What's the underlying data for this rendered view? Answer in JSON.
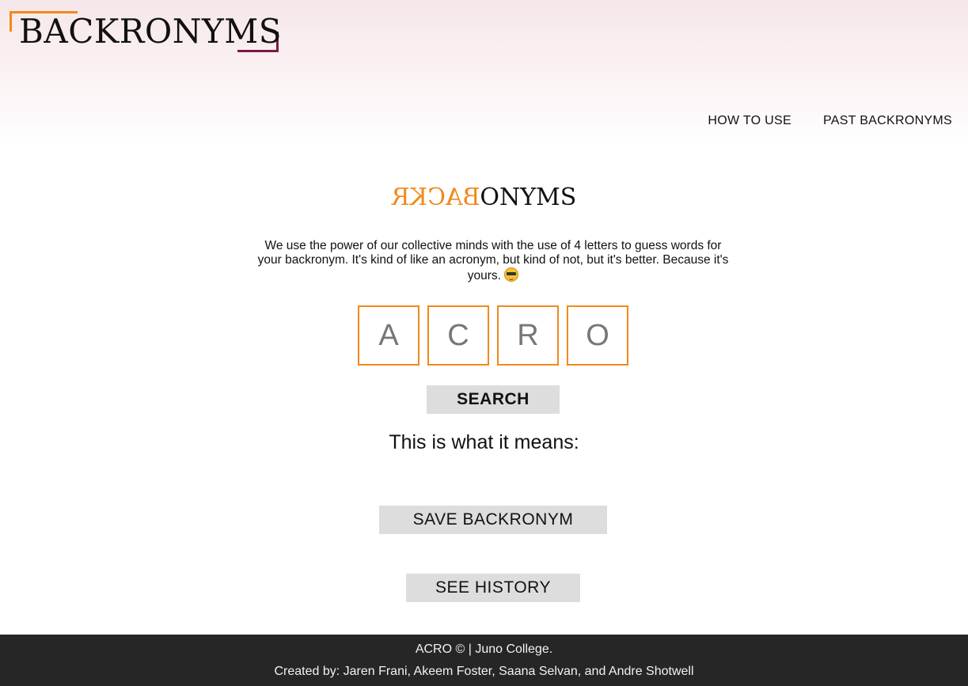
{
  "header": {
    "logo_text": "BACKRONYMS",
    "nav": [
      {
        "label": "HOW TO USE"
      },
      {
        "label": "PAST BACKRONYMS"
      }
    ]
  },
  "main": {
    "brand_flipped": "BACKR",
    "brand_rest": "ONYMS",
    "intro": "We use the power of our collective minds with the use of 4 letters to guess words for your backronym. It's kind of like an acronym, but kind of not, but it's better. Because it's yours.",
    "emoji_icon": "sunglasses-emoji-icon",
    "letters": [
      "A",
      "C",
      "R",
      "O"
    ],
    "search_label": "SEARCH",
    "meaning_label": "This is what it means:",
    "save_label": "SAVE BACKRONYM",
    "history_label": "SEE HISTORY"
  },
  "footer": {
    "copyright": "ACRO © | Juno College.",
    "credits": "Created by: Jaren Frani, Akeem Foster, Saana Selvan, and Andre Shotwell"
  },
  "colors": {
    "accent_orange": "#f08a1c",
    "accent_maroon": "#7a1c45",
    "button_gray": "#dddddd",
    "footer_bg": "#262626"
  }
}
